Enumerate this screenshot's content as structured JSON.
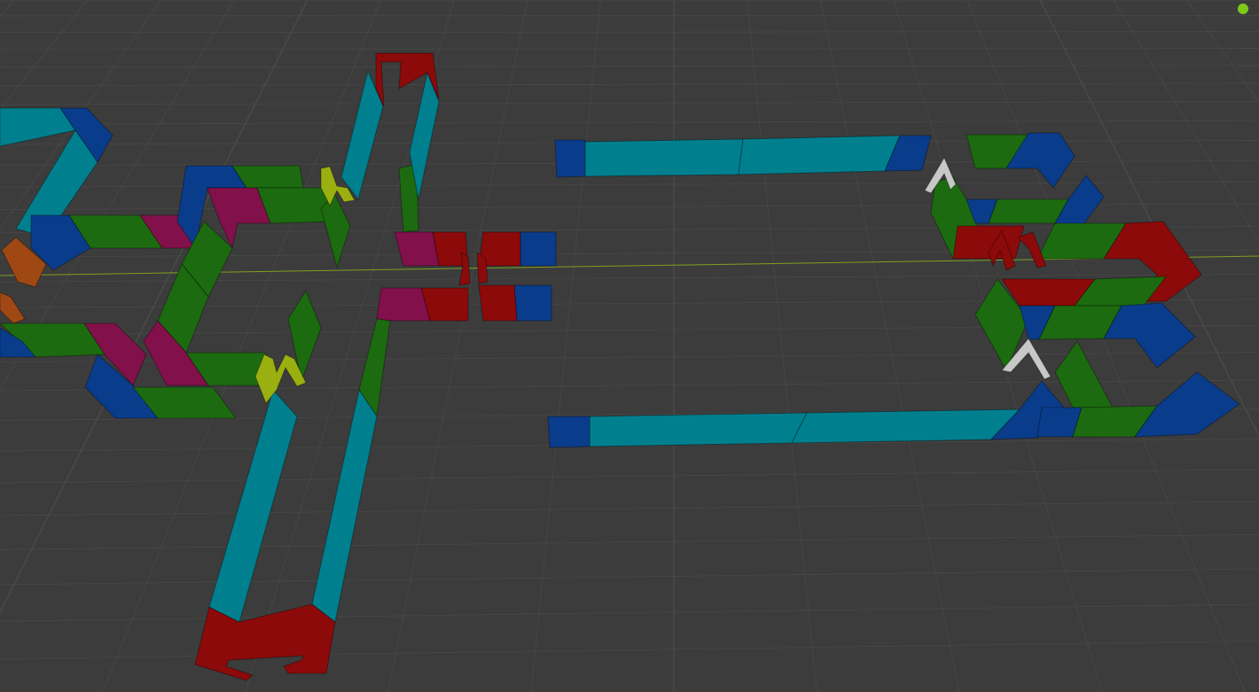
{
  "viewport": {
    "background": "#3c3c3c",
    "grid_color": "#4a4a4a",
    "axis_color": "#7fa020"
  },
  "status_indicator": {
    "color": "#7ec81a",
    "state": "active"
  },
  "palette": {
    "cyan": "#00808f",
    "blue": "#0a3c8c",
    "green": "#1d6b10",
    "magenta": "#82104a",
    "red": "#8c0a0a",
    "orange": "#a04814",
    "yellow": "#9ab010",
    "gray": "#c8c8c8"
  },
  "track_pieces": [
    {
      "name": "cyan-straight",
      "color": "cyan"
    },
    {
      "name": "blue-corner",
      "color": "blue"
    },
    {
      "name": "green-segment",
      "color": "green"
    },
    {
      "name": "magenta-segment",
      "color": "magenta"
    },
    {
      "name": "red-curve",
      "color": "red"
    },
    {
      "name": "orange-segment",
      "color": "orange"
    },
    {
      "name": "yellow-connector",
      "color": "yellow"
    },
    {
      "name": "gray-connector",
      "color": "gray"
    }
  ]
}
